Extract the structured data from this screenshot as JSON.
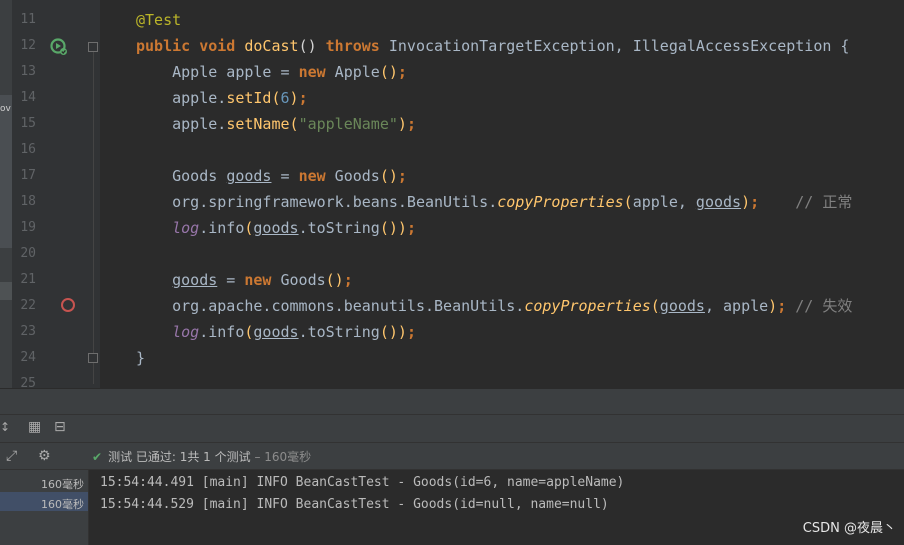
{
  "editor": {
    "line_numbers": [
      "11",
      "12",
      "13",
      "14",
      "15",
      "16",
      "17",
      "18",
      "19",
      "20",
      "21",
      "22",
      "23",
      "24",
      "25"
    ],
    "sidebar_fragment": "ov"
  },
  "code": {
    "l11_ann": "@Test",
    "l12_kw1": "public",
    "l12_kw2": "void",
    "l12_fn": "doCast",
    "l12_paren": "()",
    "l12_kw3": "throws",
    "l12_ex1": "InvocationTargetException",
    "l12_comma": ", ",
    "l12_ex2": "IllegalAccessException",
    "l12_brace": " {",
    "l13_cls": "Apple",
    "l13_var": " apple = ",
    "l13_kw": "new",
    "l13_cls2": " Apple",
    "l13_paren": "()",
    "l13_end": ";",
    "l14_obj": "apple.",
    "l14_fn": "setId",
    "l14_p1": "(",
    "l14_num": "6",
    "l14_p2": ")",
    "l14_end": ";",
    "l15_obj": "apple.",
    "l15_fn": "setName",
    "l15_p1": "(",
    "l15_str": "\"appleName\"",
    "l15_p2": ")",
    "l15_end": ";",
    "l17_cls": "Goods",
    "l17_sp": " ",
    "l17_var": "goods",
    "l17_eq": " = ",
    "l17_kw": "new",
    "l17_cls2": " Goods",
    "l17_paren": "()",
    "l17_end": ";",
    "l18_pkg": "org.springframework.beans.BeanUtils.",
    "l18_fn": "copyProperties",
    "l18_p1": "(",
    "l18_a1": "apple, ",
    "l18_a2": "goods",
    "l18_p2": ")",
    "l18_end": ";    ",
    "l18_cmt": "// 正常",
    "l19_log": "log",
    "l19_dot": ".",
    "l19_fn": "info",
    "l19_p1": "(",
    "l19_var": "goods",
    "l19_dot2": ".",
    "l19_fn2": "toString",
    "l19_p2": "())",
    "l19_end": ";",
    "l21_var": "goods",
    "l21_eq": " = ",
    "l21_kw": "new",
    "l21_cls": " Goods",
    "l21_paren": "()",
    "l21_end": ";",
    "l22_pkg": "org.apache.commons.beanutils.BeanUtils.",
    "l22_fn": "copyProperties",
    "l22_p1": "(",
    "l22_a1": "goods",
    "l22_a2": ", apple",
    "l22_p2": ")",
    "l22_end": "; ",
    "l22_cmt": "// 失效",
    "l23_log": "log",
    "l23_dot": ".",
    "l23_fn": "info",
    "l23_p1": "(",
    "l23_var": "goods",
    "l23_dot2": ".",
    "l23_fn2": "toString",
    "l23_p2": "())",
    "l23_end": ";",
    "l24_brace": "}"
  },
  "test_panel": {
    "status_check": "✔",
    "status_text": "测试 已通过: 1共 1 个测试",
    "status_duration": " – 160毫秒",
    "tree_items": [
      "160毫秒",
      "160毫秒"
    ]
  },
  "console": {
    "lines": [
      "15:54:44.491 [main] INFO BeanCastTest - Goods(id=6, name=appleName)",
      "15:54:44.529 [main] INFO BeanCastTest - Goods(id=null, name=null)"
    ]
  },
  "watermark": "CSDN @夜晨丶",
  "colors": {
    "background": "#2b2b2b",
    "keyword": "#cc7832",
    "annotation": "#bbb529",
    "string": "#6a8759",
    "function": "#ffc66d",
    "pass": "#59a869",
    "breakpoint": "#c75450"
  }
}
